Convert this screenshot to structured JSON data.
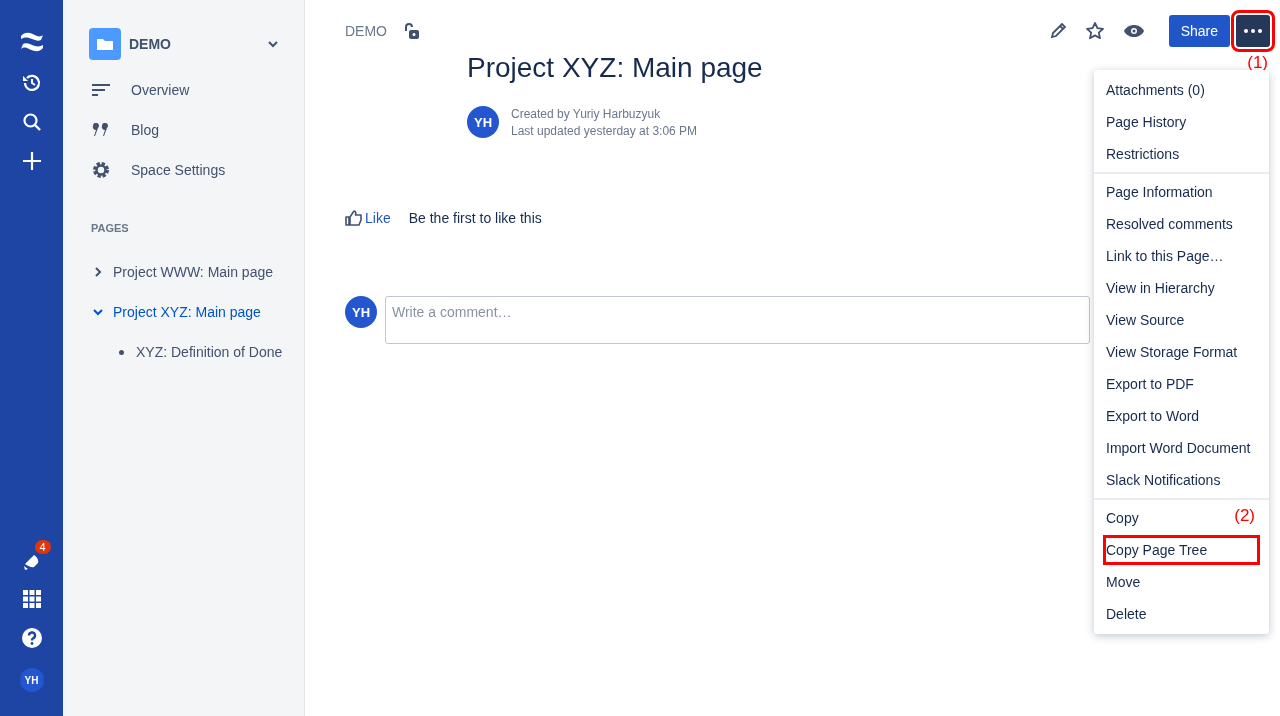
{
  "global_nav": {
    "notification_count": "4",
    "avatar": "YH"
  },
  "space": {
    "name": "DEMO"
  },
  "sidebar": {
    "items": [
      {
        "label": "Overview",
        "kind": "overview"
      },
      {
        "label": "Blog",
        "kind": "blog"
      },
      {
        "label": "Space Settings",
        "kind": "settings"
      }
    ],
    "pages_heading": "PAGES",
    "pages": [
      {
        "title": "Project WWW: Main page",
        "expanded": false,
        "selected": false
      },
      {
        "title": "Project XYZ: Main page",
        "expanded": true,
        "selected": true,
        "children": [
          {
            "title": "XYZ: Definition of Done",
            "selected": false
          }
        ]
      }
    ]
  },
  "breadcrumb": "DEMO",
  "toolbar": {
    "share": "Share",
    "more_highlighted": true,
    "more_annotation": "(1)"
  },
  "page": {
    "title": "Project XYZ: Main page",
    "avatar": "YH",
    "created_by": "Created by Yuriy Harbuzyuk",
    "last_updated": "Last updated yesterday at 3:06 PM"
  },
  "like": {
    "label": "Like",
    "text": "Be the first to like this"
  },
  "comment": {
    "avatar": "YH",
    "placeholder": "Write a comment…"
  },
  "menu": {
    "groups": [
      {
        "items": [
          {
            "label": "Attachments (0)",
            "highlighted": false
          },
          {
            "label": "Page History",
            "highlighted": false
          },
          {
            "label": "Restrictions",
            "highlighted": false
          }
        ]
      },
      {
        "items": [
          {
            "label": "Page Information",
            "highlighted": false
          },
          {
            "label": "Resolved comments",
            "highlighted": false
          },
          {
            "label": "Link to this Page…",
            "highlighted": false
          },
          {
            "label": "View in Hierarchy",
            "highlighted": false
          },
          {
            "label": "View Source",
            "highlighted": false
          },
          {
            "label": "View Storage Format",
            "highlighted": false
          },
          {
            "label": "Export to PDF",
            "highlighted": false
          },
          {
            "label": "Export to Word",
            "highlighted": false
          },
          {
            "label": "Import Word Document",
            "highlighted": false
          },
          {
            "label": "Slack Notifications",
            "highlighted": false
          }
        ]
      },
      {
        "items": [
          {
            "label": "Copy",
            "highlighted": false
          },
          {
            "label": "Copy Page Tree",
            "highlighted": true,
            "annotation": "(2)"
          },
          {
            "label": "Move",
            "highlighted": false
          },
          {
            "label": "Delete",
            "highlighted": false
          }
        ]
      }
    ]
  }
}
